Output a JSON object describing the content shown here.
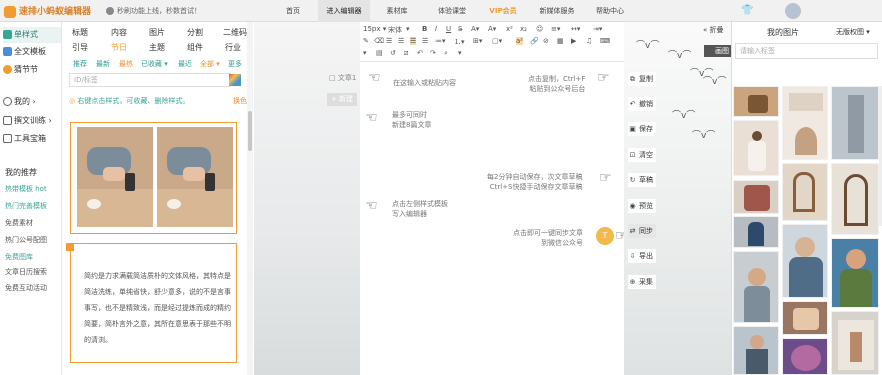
{
  "header": {
    "logo": "速排小蚂蚁编辑器",
    "notice": "秒刷功能上线，秒数首试！",
    "nav": [
      "首页",
      "进入编辑器",
      "素材库",
      "体验课堂",
      "VIP会员",
      "新媒体服务",
      "帮助中心"
    ],
    "active_nav": "进入编辑器"
  },
  "sidebar": {
    "items": [
      {
        "label": "单样式",
        "active": true
      },
      {
        "label": "全文模板",
        "active": false
      },
      {
        "label": "猜节节",
        "active": false
      }
    ],
    "section_items": [
      {
        "label": "我的"
      },
      {
        "label": "撰文训练"
      },
      {
        "label": "工具宝箱"
      }
    ],
    "links": [
      {
        "label": "我的推荐",
        "green": false
      },
      {
        "label": "热带模板 hot",
        "green": true
      },
      {
        "label": "热门完善模板",
        "green": true
      },
      {
        "label": "免费素材",
        "green": false
      },
      {
        "label": "热门公号配图",
        "green": false
      },
      {
        "label": "免费图库",
        "green": true
      },
      {
        "label": "文章日历搜索",
        "green": false
      },
      {
        "label": "免费互动活动",
        "green": false
      }
    ]
  },
  "panel": {
    "categories_row1": [
      "标题",
      "内容",
      "图片",
      "分割",
      "二维码"
    ],
    "categories_row2": [
      "引导",
      "节日",
      "主题",
      "组件",
      "行业"
    ],
    "selected_category": "节日",
    "subtabs": [
      {
        "label": "推荐",
        "orange": false
      },
      {
        "label": "最新",
        "orange": false
      },
      {
        "label": "最热",
        "orange": true
      },
      {
        "label": "已收藏 ▾",
        "orange": false
      },
      {
        "label": "最近",
        "orange": false
      },
      {
        "label": "全部 ▾",
        "orange": true
      },
      {
        "label": "更多",
        "orange": false
      }
    ],
    "tag_search_placeholder": "ID/标签",
    "tips": "右键点击样式，可收藏、删除样式。",
    "reset": "换色",
    "template_text": "简约是力求满载简洁质朴的文体风格，其特点是简洁洗练，单纯省快，舒少意多，说的不是言事事写，也不是精致浅，而是经过提炼而成的精约简要，简朴言外之意，其所在意思表于那些不明的清浏。"
  },
  "editor": {
    "doc_chip": "□ 文章1",
    "new_button": "+ 新建",
    "font_size": "15px ▾",
    "font_family": "宋体",
    "hints": {
      "input": "在这输入或粘贴内容",
      "copy_l1": "点击复制，Ctrl+F",
      "copy_l2": "粘贴到公众号后台",
      "new_l1": "最多可同时",
      "new_l2": "新建8篇文章",
      "autosave_l1": "每2分钟自动保存，次文章草稿",
      "autosave_l2": "Ctrl+S快捷手动保存文章草稿",
      "click_l1": "点击左侧样式模板",
      "click_l2": "写入编辑器",
      "sync_l1": "点击即可一键同步文章",
      "sync_l2": "到微信公众号"
    },
    "t_icon": "T"
  },
  "tools": {
    "fold": "« 折叠",
    "draw": "画图",
    "buttons": [
      {
        "icon": "⧉",
        "label": "复制",
        "active": false
      },
      {
        "icon": "↶",
        "label": "撤销",
        "active": false
      },
      {
        "icon": "▣",
        "label": "保存",
        "active": false
      },
      {
        "icon": "⊡",
        "label": "清空",
        "active": false
      },
      {
        "icon": "↻",
        "label": "草稿",
        "active": false
      },
      {
        "icon": "◉",
        "label": "预览",
        "active": false
      },
      {
        "icon": "⇄",
        "label": "同步",
        "active": true
      },
      {
        "icon": "⇩",
        "label": "导出",
        "active": false
      },
      {
        "icon": "⊕",
        "label": "采集",
        "active": false
      }
    ]
  },
  "images": {
    "title": "我的图片",
    "tab": "无版权图 ▾",
    "search_placeholder": "请输入标签"
  },
  "colors": {
    "accent": "#f29b30",
    "teal": "#3aa497"
  }
}
